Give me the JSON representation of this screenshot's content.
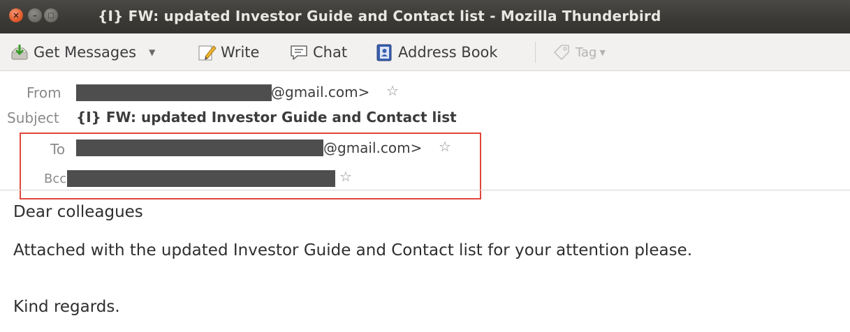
{
  "window": {
    "title": "{I} FW: updated Investor Guide and Contact list - Mozilla Thunderbird",
    "close_glyph": "×",
    "min_glyph": "–",
    "max_glyph": "□"
  },
  "toolbar": {
    "get_messages": "Get Messages",
    "write": "Write",
    "chat": "Chat",
    "address_book": "Address Book",
    "tag": "Tag"
  },
  "header": {
    "from_label": "From",
    "from_value": "@gmail.com>",
    "subject_label": "Subject",
    "subject_value": "{I} FW: updated Investor Guide and Contact list",
    "to_label": "To",
    "to_value": "@gmail.com>",
    "bcc_label": "Bcc",
    "star_glyph": "☆"
  },
  "body": {
    "greeting": "Dear colleagues",
    "line1": "Attached with the updated Investor Guide and Contact list for your attention please.",
    "closing": "Kind regards."
  },
  "colors": {
    "highlight_border": "#e0453a",
    "titlebar": "#3c3b37",
    "close_button": "#e05a2b",
    "redaction": "#4e4e4e"
  },
  "icons": [
    "close-icon",
    "minimize-icon",
    "maximize-icon",
    "get-messages-icon",
    "write-icon",
    "chat-icon",
    "address-book-icon",
    "tag-icon",
    "star-icon"
  ]
}
